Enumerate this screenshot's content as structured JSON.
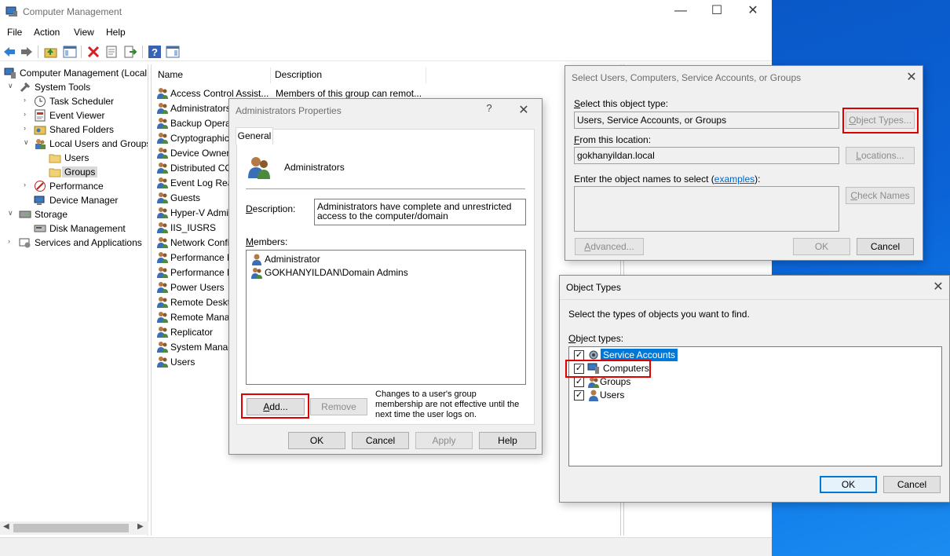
{
  "window": {
    "title": "Computer Management"
  },
  "menu": [
    "File",
    "Action",
    "View",
    "Help"
  ],
  "tree": {
    "root": "Computer Management (Local",
    "system_tools": "System Tools",
    "task_scheduler": "Task Scheduler",
    "event_viewer": "Event Viewer",
    "shared_folders": "Shared Folders",
    "local_users_groups": "Local Users and Groups",
    "users": "Users",
    "groups": "Groups",
    "performance": "Performance",
    "device_manager": "Device Manager",
    "storage": "Storage",
    "disk_management": "Disk Management",
    "services_apps": "Services and Applications"
  },
  "list": {
    "col_name": "Name",
    "col_description": "Description",
    "rows": [
      {
        "name": "Access Control Assist...",
        "desc": "Members of this group can remot..."
      },
      {
        "name": "Administrators",
        "desc": ""
      },
      {
        "name": "Backup Operat",
        "desc": ""
      },
      {
        "name": "Cryptographic",
        "desc": ""
      },
      {
        "name": "Device Owners",
        "desc": ""
      },
      {
        "name": "Distributed CO",
        "desc": ""
      },
      {
        "name": "Event Log Rea",
        "desc": ""
      },
      {
        "name": "Guests",
        "desc": ""
      },
      {
        "name": "Hyper-V Admi",
        "desc": ""
      },
      {
        "name": "IIS_IUSRS",
        "desc": ""
      },
      {
        "name": "Network Confi",
        "desc": ""
      },
      {
        "name": "Performance L",
        "desc": ""
      },
      {
        "name": "Performance M",
        "desc": ""
      },
      {
        "name": "Power Users",
        "desc": ""
      },
      {
        "name": "Remote Deskto",
        "desc": ""
      },
      {
        "name": "Remote Manag",
        "desc": ""
      },
      {
        "name": "Replicator",
        "desc": ""
      },
      {
        "name": "System Manag",
        "desc": ""
      },
      {
        "name": "Users",
        "desc": ""
      }
    ]
  },
  "admin_props": {
    "title": "Administrators Properties",
    "help_glyph": "?",
    "tab": "General",
    "group_name": "Administrators",
    "description_label": "Description:",
    "description_value": "Administrators have complete and unrestricted access to the computer/domain",
    "members_label": "Members:",
    "members": [
      "Administrator",
      "GOKHANYILDAN\\Domain Admins"
    ],
    "add_button": "Add...",
    "remove_button": "Remove",
    "note": "Changes to a user's group membership are not effective until the next time the user logs on.",
    "ok": "OK",
    "cancel": "Cancel",
    "apply": "Apply",
    "help": "Help"
  },
  "select_users": {
    "title": "Select Users, Computers, Service Accounts, or Groups",
    "object_type_label": "Select this object type:",
    "object_type_value": "Users, Service Accounts, or Groups",
    "object_types_button": "Object Types...",
    "location_label": "From this location:",
    "location_value": "gokhanyildan.local",
    "locations_button": "Locations...",
    "enter_names_label": "Enter the object names to select (",
    "examples_link": "examples",
    "enter_names_suffix": "):",
    "check_names_button": "Check Names",
    "advanced_button": "Advanced...",
    "ok": "OK",
    "cancel": "Cancel"
  },
  "object_types": {
    "title": "Object Types",
    "instruction": "Select the types of objects you want to find.",
    "list_label": "Object types:",
    "items": [
      {
        "label": "Service Accounts",
        "checked": true
      },
      {
        "label": "Computers",
        "checked": true
      },
      {
        "label": "Groups",
        "checked": true
      },
      {
        "label": "Users",
        "checked": true
      }
    ],
    "ok": "OK",
    "cancel": "Cancel"
  },
  "colors": {
    "highlight": "#0078d7",
    "annotation_red": "#e00000",
    "desktop": "#0b63d6"
  }
}
